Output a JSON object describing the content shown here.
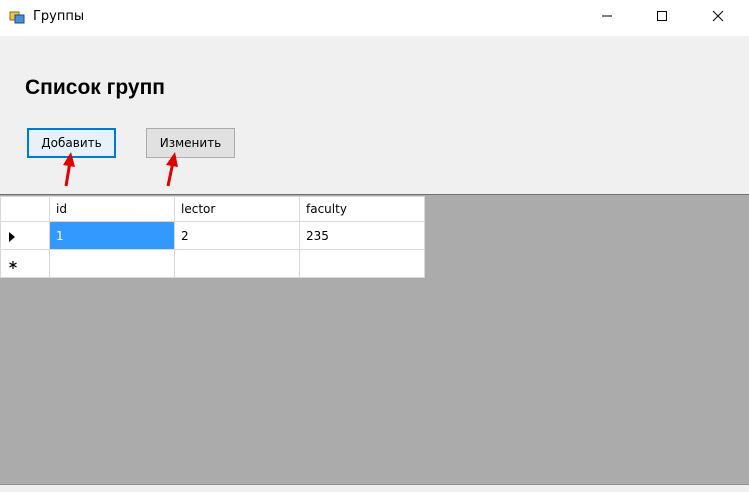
{
  "window": {
    "title": "Группы",
    "icon": "app-window-icon"
  },
  "main": {
    "heading": "Список групп",
    "add_label": "Добавить",
    "edit_label": "Изменить"
  },
  "grid": {
    "columns": [
      "id",
      "lector",
      "faculty"
    ],
    "rows": [
      {
        "marker": "current-row-icon",
        "cells": [
          "1",
          "2",
          "235"
        ],
        "selected_cell": 0
      },
      {
        "marker": "new-row-icon",
        "cells": [
          "",
          "",
          ""
        ]
      }
    ]
  },
  "annotations": {
    "arrow_color": "#e00000"
  }
}
